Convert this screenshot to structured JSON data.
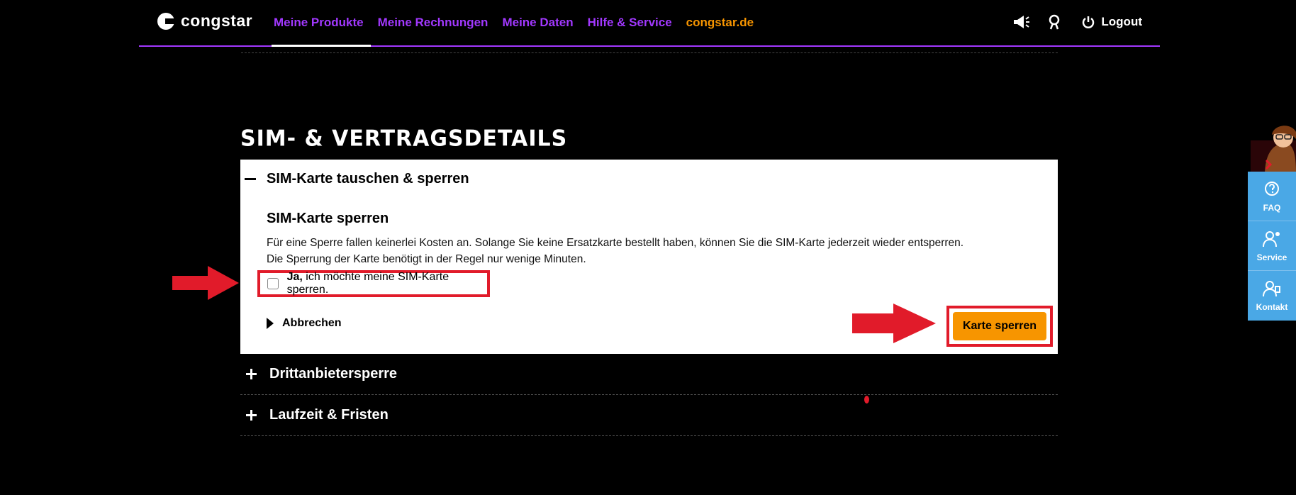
{
  "header": {
    "logo_text": "congstar",
    "nav": [
      {
        "label": "Meine Produkte",
        "active": true
      },
      {
        "label": "Meine Rechnungen"
      },
      {
        "label": "Meine Daten"
      },
      {
        "label": "Hilfe & Service"
      },
      {
        "label": "congstar.de",
        "highlight": "orange"
      }
    ],
    "logout_label": "Logout",
    "icons": [
      "megaphone-icon",
      "user-icon",
      "power-icon"
    ]
  },
  "section": {
    "title": "SIM- & VERTRAGSDETAILS",
    "open_panel": {
      "title": "SIM-Karte tauschen & sperren",
      "subtitle": "SIM-Karte sperren",
      "desc_line1": "Für eine Sperre fallen keinerlei Kosten an. Solange Sie keine Ersatzkarte bestellt haben, können Sie die SIM-Karte jederzeit wieder entsperren.",
      "desc_line2": "Die Sperrung der Karte benötigt in der Regel nur wenige Minuten.",
      "checkbox_bold": "Ja,",
      "checkbox_text": " ich möchte meine SIM-Karte sperren.",
      "checkbox_checked": false,
      "cancel_label": "Abbrechen",
      "confirm_label": "Karte sperren"
    },
    "collapsed": [
      {
        "label": "Drittanbietersperre"
      },
      {
        "label": "Laufzeit & Fristen"
      }
    ]
  },
  "side_widget": {
    "help_badge": "?",
    "items": [
      {
        "label": "FAQ",
        "icon": "faq-icon"
      },
      {
        "label": "Service",
        "icon": "service-icon"
      },
      {
        "label": "Kontakt",
        "icon": "contact-icon"
      }
    ]
  },
  "colors": {
    "accent_purple": "#a238ff",
    "accent_orange": "#f79500",
    "annotation_red": "#e11b2a",
    "side_blue": "#4aa8e6"
  }
}
